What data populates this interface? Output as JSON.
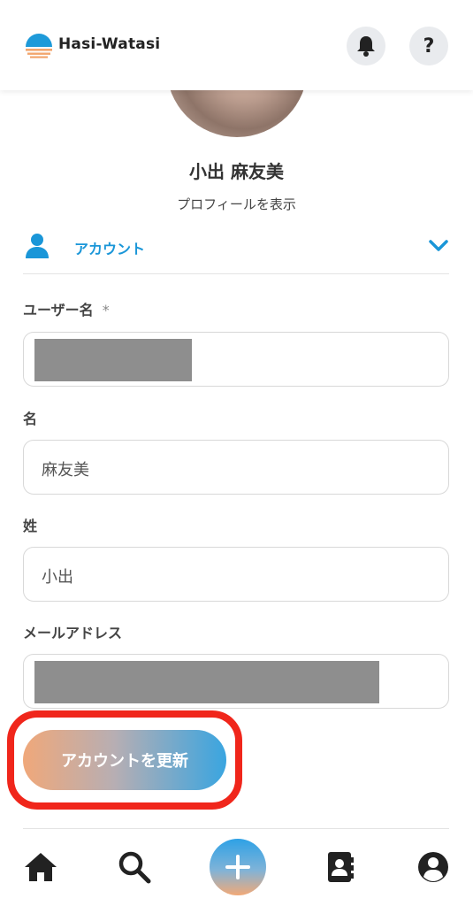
{
  "app": {
    "brand": "Hasi-Watasi"
  },
  "profile": {
    "name": "小出 麻友美",
    "view_profile": "プロフィールを表示"
  },
  "section": {
    "title": "アカウント"
  },
  "form": {
    "username": {
      "label": "ユーザー名",
      "required_mark": "*"
    },
    "first_name": {
      "label": "名",
      "value": "麻友美"
    },
    "last_name": {
      "label": "姓",
      "value": "小出"
    },
    "email": {
      "label": "メールアドレス"
    }
  },
  "actions": {
    "update_label": "アカウントを更新"
  },
  "icons": {
    "header": [
      "bell-icon",
      "help-icon"
    ],
    "nav": [
      "home-icon",
      "search-icon",
      "plus-icon",
      "contacts-icon",
      "account-icon"
    ]
  },
  "colors": {
    "accent": "#1a96d8",
    "highlight": "#f0261b",
    "gradient_start": "#f0a87a",
    "gradient_end": "#3aa5e0"
  }
}
